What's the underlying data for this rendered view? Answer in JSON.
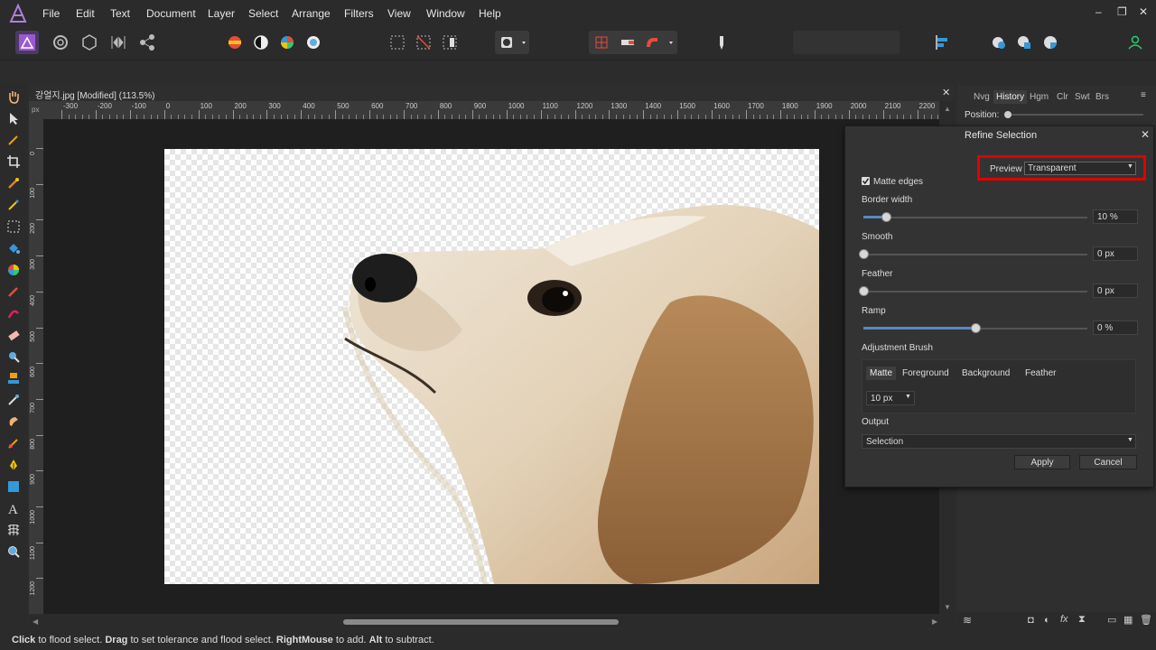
{
  "menubar": {
    "items": [
      "File",
      "Edit",
      "Text",
      "Document",
      "Layer",
      "Select",
      "Arrange",
      "Filters",
      "View",
      "Window",
      "Help"
    ],
    "controls": [
      "–",
      "❐",
      "✕"
    ]
  },
  "document": {
    "tab_title": "강얼지.jpg [Modified] (113.5%)",
    "close": "✕",
    "ruler_unit": "px",
    "hruler_ticks": [
      "-300",
      "-200",
      "-100",
      "0",
      "100",
      "200",
      "300",
      "400",
      "500",
      "600",
      "700",
      "800",
      "900",
      "1000",
      "1100",
      "1200",
      "1300",
      "1400",
      "1500",
      "1600",
      "1700",
      "1800",
      "1900",
      "2000",
      "2100",
      "2200"
    ],
    "vruler_ticks": [
      "0",
      "100",
      "200",
      "300",
      "400",
      "500",
      "600",
      "700",
      "800",
      "900",
      "1000",
      "1100",
      "1200"
    ]
  },
  "right_panel": {
    "tabs": [
      "Nvg",
      "History",
      "Hgm",
      "Clr",
      "Swt",
      "Brs"
    ],
    "position_label": "Position:"
  },
  "dialog": {
    "title": "Refine Selection",
    "close": "✕",
    "preview_label": "Preview",
    "preview_value": "Transparent",
    "matte_edges_label": "Matte edges",
    "matte_edges_checked": true,
    "border_width": {
      "label": "Border width",
      "value": "10 %",
      "level": 0.1
    },
    "smooth": {
      "label": "Smooth",
      "value": "0 px",
      "level": 0.0
    },
    "feather": {
      "label": "Feather",
      "value": "0 px",
      "level": 0.0
    },
    "ramp": {
      "label": "Ramp",
      "value": "0 %",
      "level": 0.5
    },
    "adjustment_brush_label": "Adjustment Brush",
    "brush_modes": [
      "Matte",
      "Foreground",
      "Background",
      "Feather"
    ],
    "brush_size": "10 px",
    "output_label": "Output",
    "output_value": "Selection",
    "apply": "Apply",
    "cancel": "Cancel"
  },
  "status": {
    "bold1": "Click",
    "t1": " to flood select. ",
    "bold2": "Drag",
    "t2": " to set tolerance and flood select. ",
    "bold3": "RightMouse",
    "t3": " to add. ",
    "bold4": "Alt",
    "t4": " to subtract."
  },
  "colors": {
    "accent": "#5b87c5",
    "highlight": "#e00000",
    "logo": "#9b59d0"
  }
}
